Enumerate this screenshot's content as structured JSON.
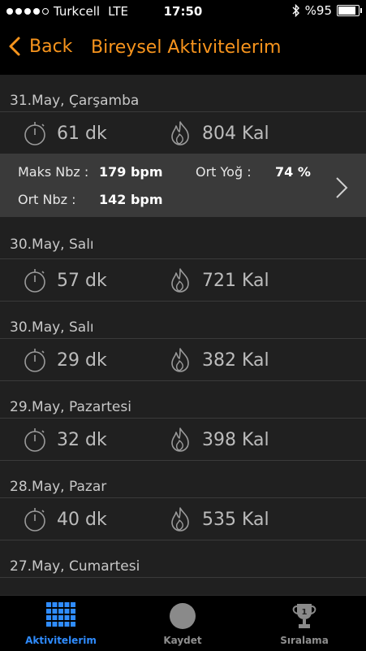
{
  "status": {
    "carrier": "Turkcell",
    "network": "LTE",
    "time": "17:50",
    "battery": "%95"
  },
  "nav": {
    "back_label": "Back",
    "title": "Bireysel Aktivitelerim"
  },
  "colors": {
    "accent": "#f7941d",
    "active_tab": "#2f8cff"
  },
  "days": [
    {
      "date": "31.May, Çarşamba",
      "duration": "61 dk",
      "calories": "804 Kal"
    },
    {
      "date": "30.May, Salı",
      "duration": "57 dk",
      "calories": "721 Kal"
    },
    {
      "date": "30.May, Salı",
      "duration": "29 dk",
      "calories": "382 Kal"
    },
    {
      "date": "29.May, Pazartesi",
      "duration": "32 dk",
      "calories": "398 Kal"
    },
    {
      "date": "28.May, Pazar",
      "duration": "40 dk",
      "calories": "535 Kal"
    },
    {
      "date": "27.May, Cumartesi"
    }
  ],
  "detail": {
    "max_hr_label": "Maks Nbz :",
    "max_hr_value": "179 bpm",
    "avg_int_label": "Ort Yoğ :",
    "avg_int_value": "74 %",
    "avg_hr_label": "Ort Nbz :",
    "avg_hr_value": "142 bpm"
  },
  "tabs": [
    {
      "label": "Aktivitelerim",
      "icon": "grid-icon",
      "active": true
    },
    {
      "label": "Kaydet",
      "icon": "record-circle-icon",
      "active": false
    },
    {
      "label": "Sıralama",
      "icon": "trophy-icon",
      "active": false
    }
  ]
}
